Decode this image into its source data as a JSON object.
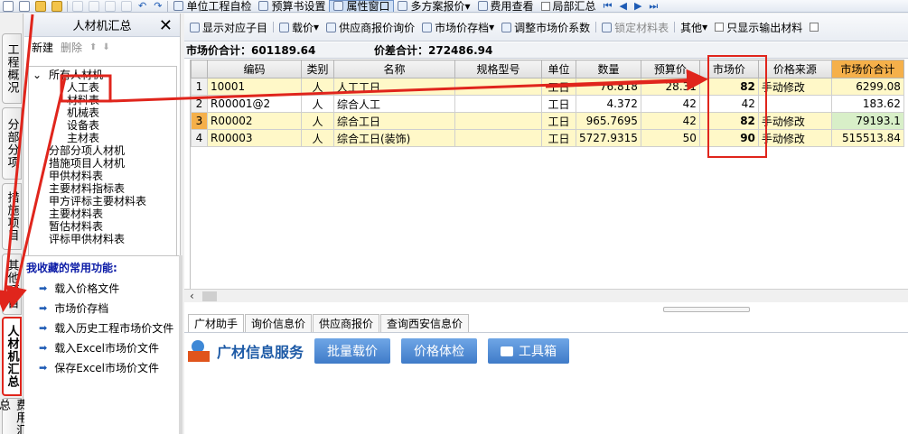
{
  "top_toolbar": {
    "items": [
      "单位工程自检",
      "预算书设置",
      "属性窗口",
      "多方案报价",
      "费用查看",
      "局部汇总"
    ]
  },
  "left_tabs": [
    "工程概况",
    "分部分项",
    "措施项目",
    "其他项目",
    "人材机汇总",
    "费用汇总"
  ],
  "left_panel": {
    "title": "人材机汇总",
    "close": "✕",
    "new_label": "新建",
    "delete_label": "删除",
    "tree": {
      "root": "所有人材机",
      "children": [
        "人工表",
        "材料表",
        "机械表",
        "设备表",
        "主材表"
      ],
      "others": [
        "分部分项人材机",
        "措施项目人材机",
        "甲供材料表",
        "主要材料指标表",
        "甲方评标主要材料表",
        "主要材料表",
        "暂估材料表",
        "评标甲供材料表"
      ]
    },
    "favorites": {
      "title": "我收藏的常用功能:",
      "items": [
        "载入价格文件",
        "市场价存档",
        "载入历史工程市场价文件",
        "载入Excel市场价文件",
        "保存Excel市场价文件"
      ]
    }
  },
  "sub_toolbar": {
    "items": [
      "显示对应子目",
      "载价",
      "供应商报价询价",
      "市场价存档",
      "调整市场价系数",
      "锁定材料表",
      "其他",
      "只显示输出材料"
    ]
  },
  "summary": {
    "market_total": "市场价合计：601189.64",
    "diff_total": "价差合计：272486.94"
  },
  "table": {
    "headers": [
      "",
      "编码",
      "类别",
      "名称",
      "规格型号",
      "单位",
      "数量",
      "预算价",
      "市场价",
      "价格来源",
      "市场价合计"
    ],
    "rows": [
      [
        "1",
        "10001",
        "人",
        "人工工日",
        "",
        "工日",
        "76.818",
        "28.31",
        "82",
        "手动修改",
        "6299.08"
      ],
      [
        "2",
        "R00001@2",
        "人",
        "综合人工",
        "",
        "工日",
        "4.372",
        "42",
        "42",
        "",
        "183.62"
      ],
      [
        "3",
        "R00002",
        "人",
        "综合工日",
        "",
        "工日",
        "965.7695",
        "42",
        "82",
        "手动修改",
        "79193.1"
      ],
      [
        "4",
        "R00003",
        "人",
        "综合工日(装饰)",
        "",
        "工日",
        "5727.9315",
        "50",
        "90",
        "手动修改",
        "515513.84"
      ]
    ]
  },
  "bottom_tabs": [
    "广材助手",
    "询价信息价",
    "供应商报价",
    "查询西安信息价"
  ],
  "banner": {
    "title": "广材信息服务",
    "buttons": [
      "批量载价",
      "价格体检",
      "工具箱"
    ]
  },
  "colors": {
    "annotation_red": "#e0251c",
    "header_orange": "#f5b04a",
    "row_yellow": "#fff8c8",
    "button_blue": "#4a86d0"
  }
}
